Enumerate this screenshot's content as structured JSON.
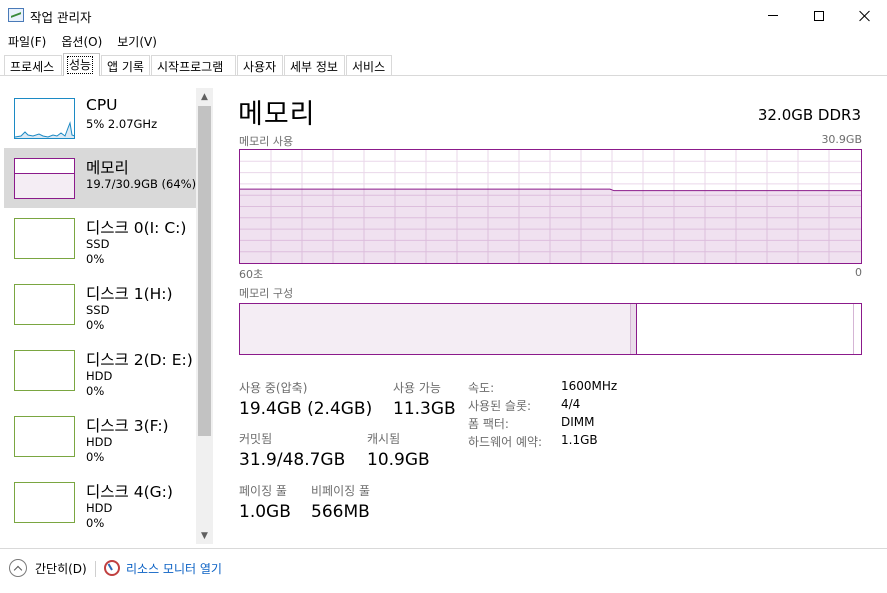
{
  "window": {
    "title": "작업 관리자",
    "icons": {
      "app": "task-manager-icon",
      "minimize": "minimize-icon",
      "maximize": "maximize-icon",
      "close": "close-icon"
    }
  },
  "menu": [
    "파일(F)",
    "옵션(O)",
    "보기(V)"
  ],
  "tabs": [
    "프로세스",
    "성능",
    "앱 기록",
    "시작프로그램",
    "사용자",
    "세부 정보",
    "서비스"
  ],
  "active_tab": "성능",
  "sidebar": {
    "items": [
      {
        "title": "CPU",
        "sub1": "5% 2.07GHz",
        "sub2": "",
        "kind": "cpu"
      },
      {
        "title": "메모리",
        "sub1": "19.7/30.9GB (64%)",
        "sub2": "",
        "kind": "memory",
        "selected": true,
        "usage_fraction": 0.64
      },
      {
        "title": "디스크 0(I: C:)",
        "sub1": "SSD",
        "sub2": "0%",
        "kind": "disk"
      },
      {
        "title": "디스크 1(H:)",
        "sub1": "SSD",
        "sub2": "0%",
        "kind": "disk"
      },
      {
        "title": "디스크 2(D: E:)",
        "sub1": "HDD",
        "sub2": "0%",
        "kind": "disk"
      },
      {
        "title": "디스크 3(F:)",
        "sub1": "HDD",
        "sub2": "0%",
        "kind": "disk"
      },
      {
        "title": "디스크 4(G:)",
        "sub1": "HDD",
        "sub2": "0%",
        "kind": "disk"
      }
    ]
  },
  "memory_panel": {
    "title": "메모리",
    "spec": "32.0GB DDR3",
    "usage_graph": {
      "label": "메모리 사용",
      "max_label": "30.9GB",
      "left_label": "60초",
      "right_label": "0",
      "usage_fraction": 0.64
    },
    "composition": {
      "label": "메모리 구성",
      "in_use_fraction": 0.63,
      "modified_fraction": 0.01,
      "standby_fraction": 0.35
    },
    "stats": {
      "in_use_label": "사용 중(압축)",
      "in_use_value": "19.4GB (2.4GB)",
      "available_label": "사용 가능",
      "available_value": "11.3GB",
      "committed_label": "커밋됨",
      "committed_value": "31.9/48.7GB",
      "cached_label": "캐시됨",
      "cached_value": "10.9GB",
      "paged_label": "페이징 풀",
      "paged_value": "1.0GB",
      "nonpaged_label": "비페이징 풀",
      "nonpaged_value": "566MB"
    },
    "details": [
      {
        "label": "속도:",
        "value": "1600MHz"
      },
      {
        "label": "사용된 슬롯:",
        "value": "4/4"
      },
      {
        "label": "폼 팩터:",
        "value": "DIMM"
      },
      {
        "label": "하드웨어 예약:",
        "value": "1.1GB"
      }
    ]
  },
  "footer": {
    "simple_label": "간단히(D)",
    "resmon_label": "리소스 모니터 열기"
  },
  "colors": {
    "memory": "#8b1a8b",
    "memory_fill": "#f4edf4",
    "cpu": "#1c8ac4",
    "disk": "#7aa641",
    "link": "#0b61c4"
  }
}
